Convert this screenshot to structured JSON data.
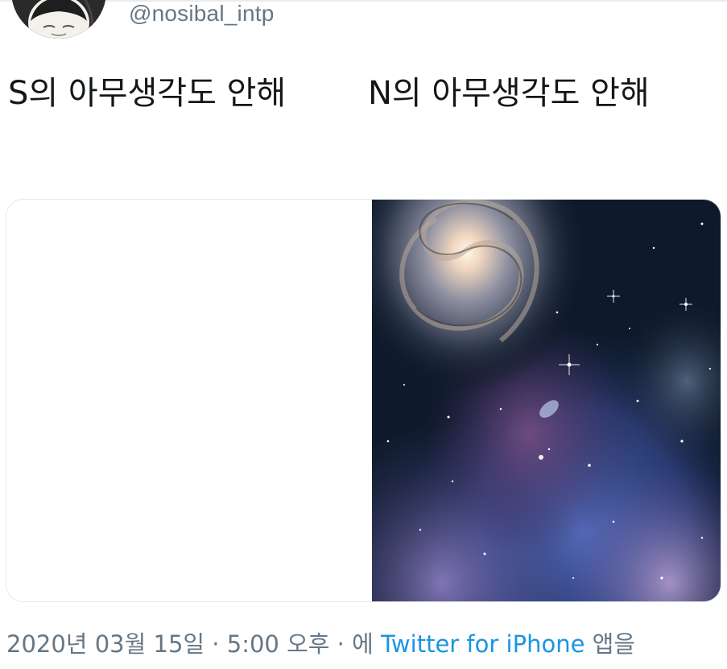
{
  "tweet": {
    "handle": "@nosibal_intp",
    "text": "S의 아무생각도 안해        N의 아무생각도 안해",
    "media": [
      {
        "kind": "blank-white-image"
      },
      {
        "kind": "galaxy-image"
      }
    ]
  },
  "footer": {
    "date": "2020년 03월 15일",
    "separator1": " · ",
    "time": "5:00 오후",
    "separator2": " · ",
    "via_prefix": "에 ",
    "source": "Twitter for iPhone",
    "via_suffix": " 앱을"
  },
  "colors": {
    "text": "#14171a",
    "muted": "#657786",
    "link": "#1b95e0",
    "border": "#e1e8ed"
  }
}
